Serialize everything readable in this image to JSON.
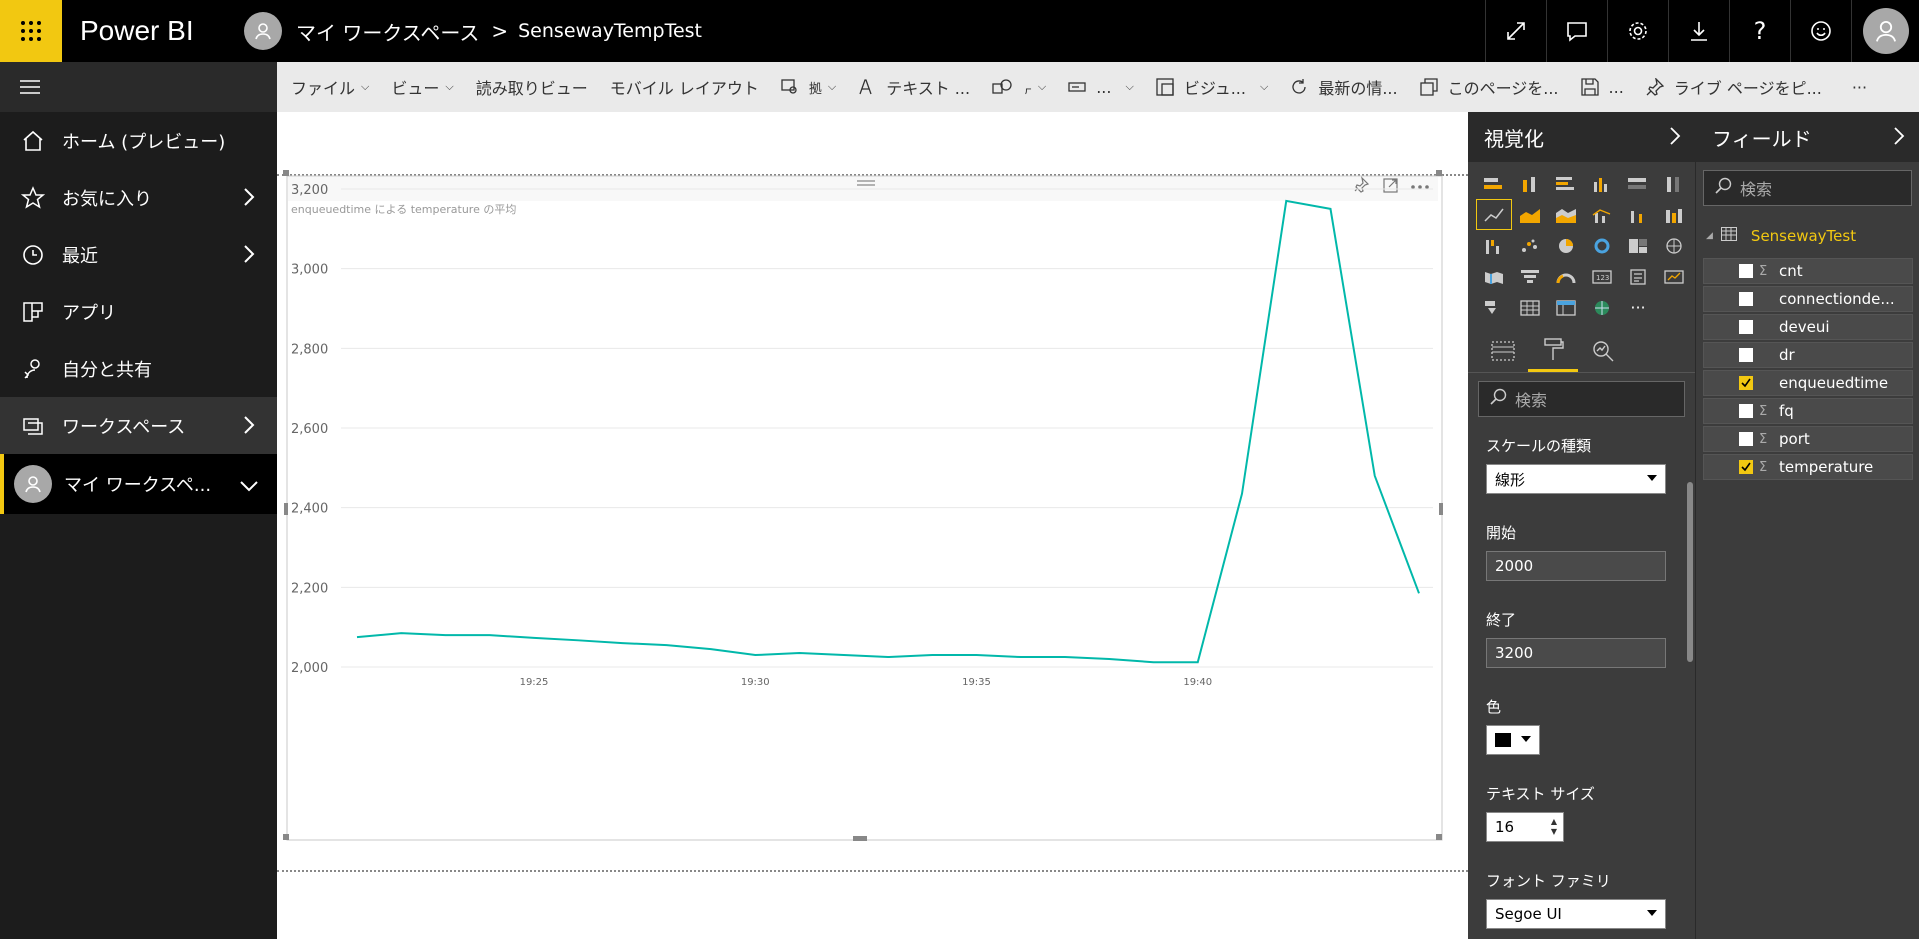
{
  "app": {
    "title": "Power BI"
  },
  "breadcrumb": {
    "workspace": "マイ ワークスペース",
    "separator": ">",
    "report": "SensewayTempTest"
  },
  "leftnav": {
    "items": [
      {
        "label": "ホーム (プレビュー)"
      },
      {
        "label": "お気に入り"
      },
      {
        "label": "最近"
      },
      {
        "label": "アプリ"
      },
      {
        "label": "自分と共有"
      },
      {
        "label": "ワークスペース"
      },
      {
        "label": "マイ ワークスペ..."
      }
    ]
  },
  "toolbar": {
    "file": "ファイル",
    "view": "ビュー",
    "reading_view": "読み取りビュー",
    "mobile_layout": "モバイル レイアウト",
    "text": "テキスト ...",
    "ellipsis_short": "...",
    "visual": "ビジュ...",
    "refresh": "最新の情...",
    "pin_page": "このページを...",
    "save": "...",
    "pin_live": "ライブ ページをピ...",
    "more": "···"
  },
  "chart_data": {
    "type": "line",
    "title": "enqueuedtime による temperature の平均",
    "xlabel": "",
    "ylabel": "",
    "ylim": [
      2000,
      3200
    ],
    "yticks": [
      "2,000",
      "2,200",
      "2,400",
      "2,600",
      "2,800",
      "3,000",
      "3,200"
    ],
    "xticks": [
      {
        "label": "19:25",
        "x": 4
      },
      {
        "label": "19:30",
        "x": 9
      },
      {
        "label": "19:35",
        "x": 14
      },
      {
        "label": "19:40",
        "x": 19
      }
    ],
    "series": [
      {
        "color": "#01b8aa",
        "x": [
          0,
          1,
          2,
          3,
          4,
          5,
          6,
          7,
          8,
          9,
          10,
          11,
          12,
          13,
          14,
          15,
          16,
          17,
          18,
          19,
          20,
          21,
          22,
          23,
          24
        ],
        "values": [
          2075,
          2085,
          2080,
          2080,
          2073,
          2067,
          2060,
          2055,
          2045,
          2030,
          2035,
          2030,
          2025,
          2030,
          2030,
          2025,
          2025,
          2020,
          2012,
          2012,
          2435,
          3170,
          3150,
          2480,
          2185
        ]
      }
    ],
    "grid": true
  },
  "viz": {
    "header": "視覚化",
    "search_placeholder": "検索",
    "scale_type_label": "スケールの種類",
    "scale_type_value": "線形",
    "start_label": "開始",
    "start_value": "2000",
    "end_label": "終了",
    "end_value": "3200",
    "color_label": "色",
    "text_size_label": "テキスト サイズ",
    "text_size_value": "16",
    "font_family_label": "フォント ファミリ",
    "font_family_value": "Segoe UI"
  },
  "fields": {
    "header": "フィールド",
    "search_placeholder": "検索",
    "table": "SensewayTest",
    "items": [
      {
        "name": "cnt",
        "checked": false,
        "sigma": true
      },
      {
        "name": "connectionde...",
        "checked": false,
        "sigma": false
      },
      {
        "name": "deveui",
        "checked": false,
        "sigma": false
      },
      {
        "name": "dr",
        "checked": false,
        "sigma": false
      },
      {
        "name": "enqueuedtime",
        "checked": true,
        "sigma": false
      },
      {
        "name": "fq",
        "checked": false,
        "sigma": true
      },
      {
        "name": "port",
        "checked": false,
        "sigma": true
      },
      {
        "name": "temperature",
        "checked": true,
        "sigma": true
      }
    ]
  }
}
